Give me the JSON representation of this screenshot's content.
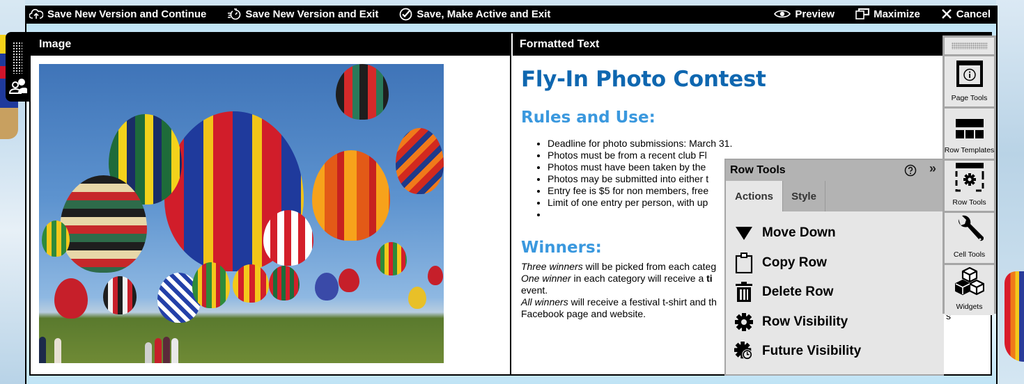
{
  "toolbar": {
    "left": [
      {
        "label": "Save New Version and Continue",
        "icon": "cloud-upload-icon"
      },
      {
        "label": "Save New Version and Exit",
        "icon": "timer-exit-icon"
      },
      {
        "label": "Save, Make Active and Exit",
        "icon": "check-circle-icon"
      }
    ],
    "right": [
      {
        "label": "Preview",
        "icon": "eye-icon"
      },
      {
        "label": "Maximize",
        "icon": "maximize-icon"
      },
      {
        "label": "Cancel",
        "icon": "close-icon"
      }
    ]
  },
  "left_tab": {
    "icons": [
      "drag-grip-icon",
      "user-permissions-icon"
    ]
  },
  "row": {
    "image_cell": {
      "header": "Image",
      "image_alt": "Hot air balloons lifting off over a field"
    },
    "text_cell": {
      "header": "Formatted Text",
      "title": "Fly-In Photo Contest",
      "rules_heading": "Rules and Use:",
      "rules": [
        "Deadline for photo submissions: March 31.",
        "Photos must be from a recent club Fl",
        "Photos must have been taken by the",
        "Photos may be submitted into either t",
        "Entry fee is $5 for non members, free",
        "Limit of one entry per person, with up",
        ""
      ],
      "winners_heading": "Winners:",
      "winners_lines": [
        {
          "em": "Three winners",
          "rest": " will be picked from each categ"
        },
        {
          "em": "One winner",
          "rest": " in each category will receive a ",
          "bold": "ti"
        },
        {
          "em": "",
          "rest": "event."
        },
        {
          "em": "All winners",
          "rest": " will receive a festival t-shirt and th"
        },
        {
          "em": "",
          "rest": "Facebook page and website."
        }
      ],
      "stray_char": "s"
    }
  },
  "row_tools": {
    "title": "Row Tools",
    "help_icon": "help-circle-icon",
    "collapse_icon": "double-chevron-right-icon",
    "collapse_glyph": "»",
    "tabs": [
      {
        "label": "Actions",
        "active": true
      },
      {
        "label": "Style",
        "active": false
      }
    ],
    "actions": [
      {
        "label": "Move Down",
        "icon": "triangle-down-icon"
      },
      {
        "label": "Copy Row",
        "icon": "clipboard-icon"
      },
      {
        "label": "Delete Row",
        "icon": "trash-icon"
      },
      {
        "label": "Row Visibility",
        "icon": "gear-icon"
      },
      {
        "label": "Future Visibility",
        "icon": "gear-clock-icon"
      }
    ]
  },
  "tool_column": {
    "items": [
      {
        "label": "Page Tools",
        "icon": "page-info-icon"
      },
      {
        "label": "Row Templates",
        "icon": "row-templates-icon"
      },
      {
        "label": "Row Tools",
        "icon": "row-gear-icon"
      },
      {
        "label": "Cell Tools",
        "icon": "wrench-icon"
      },
      {
        "label": "Widgets",
        "icon": "cubes-icon"
      }
    ]
  }
}
